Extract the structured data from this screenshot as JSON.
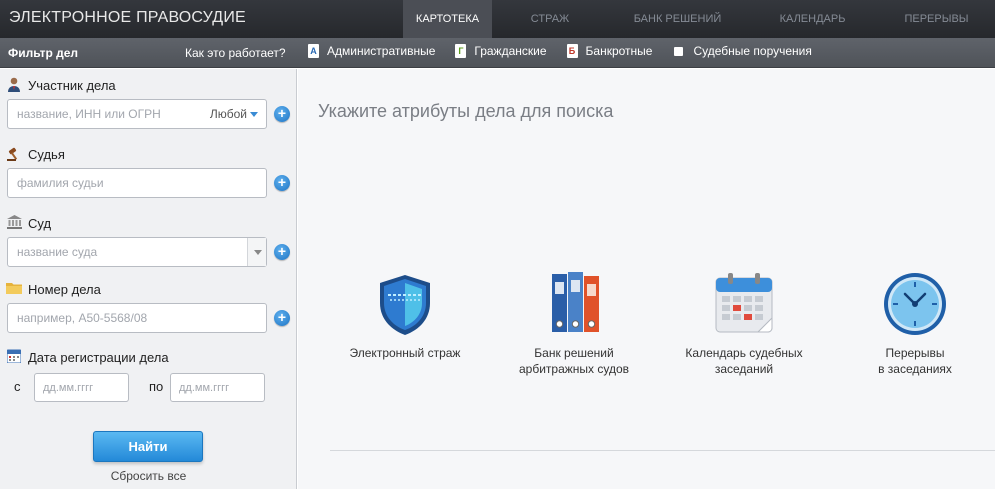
{
  "header": {
    "brand": "ЭЛЕКТРОННОЕ ПРАВОСУДИЕ",
    "tabs": [
      {
        "label": "КАРТОТЕКА",
        "active": true
      },
      {
        "label": "СТРАЖ",
        "active": false
      },
      {
        "label": "БАНК РЕШЕНИЙ",
        "active": false
      },
      {
        "label": "КАЛЕНДАРЬ",
        "active": false
      },
      {
        "label": "ПЕРЕРЫВЫ",
        "active": false
      }
    ]
  },
  "subbar": {
    "filter_title": "Фильтр дел",
    "how_it_works": "Как это работает?",
    "categories": [
      {
        "icon": "А",
        "label": "Административные"
      },
      {
        "icon": "Г",
        "label": "Гражданские"
      },
      {
        "icon": "Б",
        "label": "Банкротные"
      },
      {
        "icon": "",
        "label": "Судебные поручения"
      }
    ]
  },
  "filter": {
    "participant": {
      "label": "Участник дела",
      "placeholder": "название, ИНН или ОГРН",
      "role": "Любой"
    },
    "judge": {
      "label": "Судья",
      "placeholder": "фамилия судьи"
    },
    "court": {
      "label": "Суд",
      "placeholder": "название суда"
    },
    "case_number": {
      "label": "Номер дела",
      "placeholder": "например, А50-5568/08"
    },
    "reg_date": {
      "label": "Дата регистрации дела",
      "from_label": "с",
      "to_label": "по",
      "from_placeholder": "дд.мм.гггг",
      "to_placeholder": "дд.мм.гггг"
    },
    "find_button": "Найти",
    "reset_link": "Сбросить все"
  },
  "main": {
    "title": "Укажите атрибуты дела для поиска",
    "tiles": [
      {
        "label_line1": "Электронный страж",
        "label_line2": ""
      },
      {
        "label_line1": "Банк решений",
        "label_line2": "арбитражных судов"
      },
      {
        "label_line1": "Календарь судебных",
        "label_line2": "заседаний"
      },
      {
        "label_line1": "Перерывы",
        "label_line2": "в заседаниях"
      }
    ]
  },
  "colors": {
    "topbar": "#2c2f34",
    "active_tab": "#4b4e55",
    "accent": "#2389d8"
  }
}
